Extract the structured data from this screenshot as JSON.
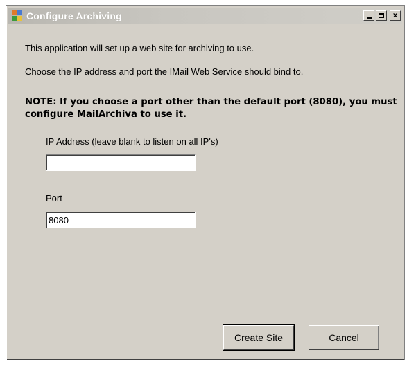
{
  "window": {
    "title": "Configure Archiving",
    "controls": {
      "minimize_label": "_",
      "maximize_label": "□",
      "close_label": "x"
    }
  },
  "body": {
    "intro_line_1": "This application will set up a web site for archiving to use.",
    "intro_line_2": "Choose the IP address and port the IMail Web Service should bind to.",
    "note": "NOTE: If you choose a port other than the default port (8080), you must configure MailArchiva to use it."
  },
  "form": {
    "ip_label": "IP Address (leave blank to listen on all IP's)",
    "ip_value": "",
    "port_label": "Port",
    "port_value": "8080"
  },
  "buttons": {
    "create_label": "Create Site",
    "cancel_label": "Cancel"
  }
}
